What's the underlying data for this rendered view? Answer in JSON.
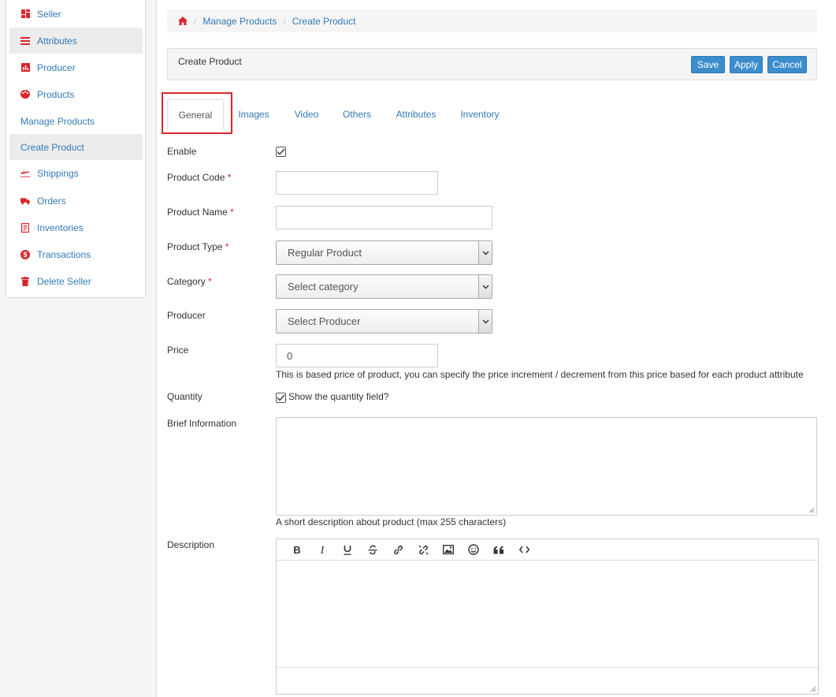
{
  "sidebar": {
    "items": [
      {
        "label": "Seller",
        "icon": "dashboard-icon"
      },
      {
        "label": "Attributes",
        "icon": "list-icon"
      },
      {
        "label": "Producer",
        "icon": "bar-chart-icon"
      },
      {
        "label": "Products",
        "icon": "palette-icon"
      },
      {
        "label": "Manage Products",
        "icon": ""
      },
      {
        "label": "Create Product",
        "icon": ""
      },
      {
        "label": "Shippings",
        "icon": "plane-icon"
      },
      {
        "label": "Orders",
        "icon": "truck-icon"
      },
      {
        "label": "Inventories",
        "icon": "document-icon"
      },
      {
        "label": "Transactions",
        "icon": "dollar-icon"
      },
      {
        "label": "Delete Seller",
        "icon": "trash-icon"
      }
    ]
  },
  "breadcrumb": {
    "home_icon": "home-icon",
    "items": [
      "Manage Products",
      "Create Product"
    ]
  },
  "panel": {
    "title": "Create Product",
    "save_label": "Save",
    "apply_label": "Apply",
    "cancel_label": "Cancel"
  },
  "tabs": [
    {
      "label": "General",
      "active": true
    },
    {
      "label": "Images",
      "active": false
    },
    {
      "label": "Video",
      "active": false
    },
    {
      "label": "Others",
      "active": false
    },
    {
      "label": "Attributes",
      "active": false
    },
    {
      "label": "Inventory",
      "active": false
    }
  ],
  "form": {
    "enable": {
      "label": "Enable",
      "checked": true
    },
    "product_code": {
      "label": "Product Code",
      "required_mark": "*",
      "value": ""
    },
    "product_name": {
      "label": "Product Name",
      "required_mark": "*",
      "value": ""
    },
    "product_type": {
      "label": "Product Type",
      "required_mark": "*",
      "value": "Regular Product"
    },
    "category": {
      "label": "Category",
      "required_mark": "*",
      "value": "Select category"
    },
    "producer": {
      "label": "Producer",
      "value": "Select Producer"
    },
    "price": {
      "label": "Price",
      "value": "0",
      "help": "This is based price of product, you can specify the price increment / decrement from this price based for each product attribute"
    },
    "quantity": {
      "label": "Quantity",
      "checkbox_label": "Show the quantity field?",
      "checked": true
    },
    "brief_information": {
      "label": "Brief Information",
      "value": "",
      "help": "A short description about product (max 255 characters)"
    },
    "description": {
      "label": "Description",
      "toolbar": [
        "bold-icon",
        "italic-icon",
        "underline-icon",
        "strikethrough-icon",
        "link-icon",
        "unlink-icon",
        "image-icon",
        "emoji-icon",
        "quote-icon",
        "code-icon"
      ]
    }
  },
  "colors": {
    "link": "#337ab7",
    "button": "#3c8dcc",
    "required": "#d9262c",
    "icon_red": "#d9262c"
  }
}
